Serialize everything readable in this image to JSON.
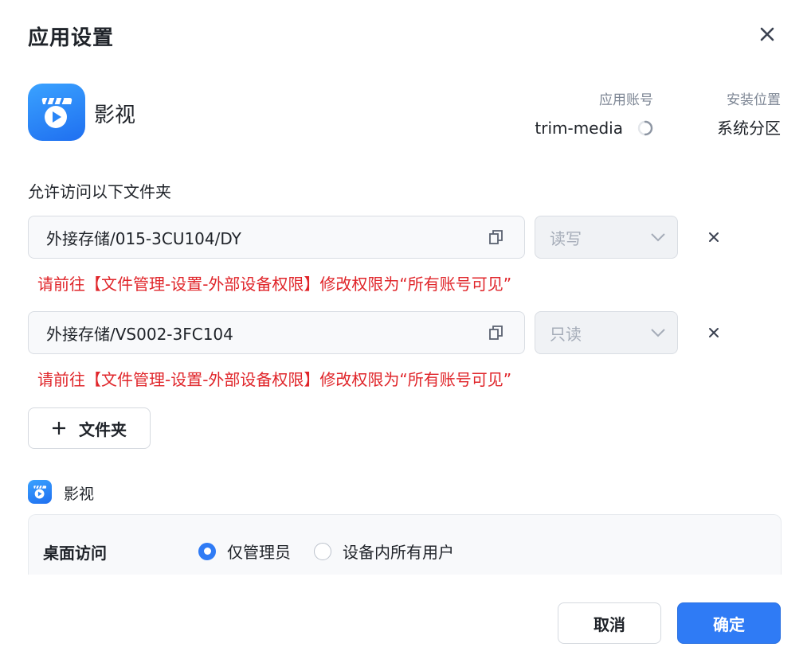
{
  "dialog": {
    "title": "应用设置"
  },
  "app": {
    "name": "影视",
    "account_label": "应用账号",
    "account_value": "trim-media",
    "location_label": "安装位置",
    "location_value": "系统分区"
  },
  "folders": {
    "section_label": "允许访问以下文件夹",
    "items": [
      {
        "path": "外接存储/015-3CU104/DY",
        "permission": "读写",
        "warning": "请前往【文件管理-设置-外部设备权限】修改权限为“所有账号可见”"
      },
      {
        "path": "外接存储/VS002-3FC104",
        "permission": "只读",
        "warning": "请前往【文件管理-设置-外部设备权限】修改权限为“所有账号可见”"
      }
    ],
    "add_label": "文件夹"
  },
  "access": {
    "app_name": "影视",
    "label": "桌面访问",
    "options": [
      "仅管理员",
      "设备内所有用户"
    ],
    "selected": "仅管理员"
  },
  "footer": {
    "cancel_label": "取消",
    "ok_label": "确定"
  },
  "colors": {
    "primary": "#2f7bf5",
    "warning": "#e0252a",
    "muted": "#7d8694"
  }
}
